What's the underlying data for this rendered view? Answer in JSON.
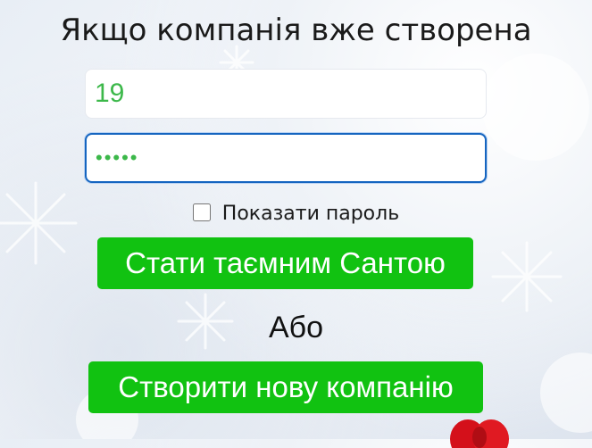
{
  "heading": "Якщо компанія вже створена",
  "company_field": {
    "value": "19"
  },
  "password_field": {
    "value": "•••••"
  },
  "show_password": {
    "label": "Показати пароль",
    "checked": false
  },
  "santa_button": {
    "label": "Стати таємним Сантою"
  },
  "or_text": "Або",
  "new_company_button": {
    "label": "Створити нову компанію"
  },
  "colors": {
    "button_green": "#11c211",
    "input_text_green": "#3cb84a",
    "focus_border": "#1565c0"
  }
}
